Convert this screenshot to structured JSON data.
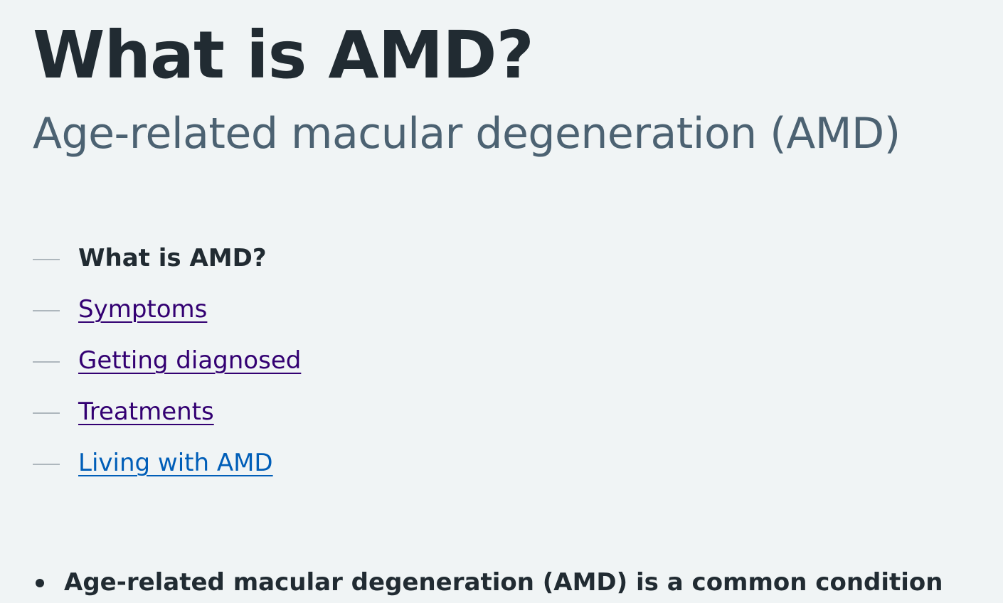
{
  "page": {
    "title": "What is AMD?",
    "subtitle": "Age-related macular degeneration (AMD)"
  },
  "contents": {
    "items": [
      {
        "label": "What is AMD?",
        "current": true
      },
      {
        "label": "Symptoms",
        "current": false
      },
      {
        "label": "Getting diagnosed",
        "current": false
      },
      {
        "label": "Treatments",
        "current": false
      },
      {
        "label": "Living with AMD",
        "current": false
      }
    ]
  },
  "summary": {
    "items": [
      "Age-related macular degeneration (AMD) is a common condition"
    ]
  },
  "colors": {
    "background": "#f0f4f5",
    "text": "#212b32",
    "subtitle": "#4c6272",
    "link_visited": "#330072",
    "link": "#005eb8"
  }
}
